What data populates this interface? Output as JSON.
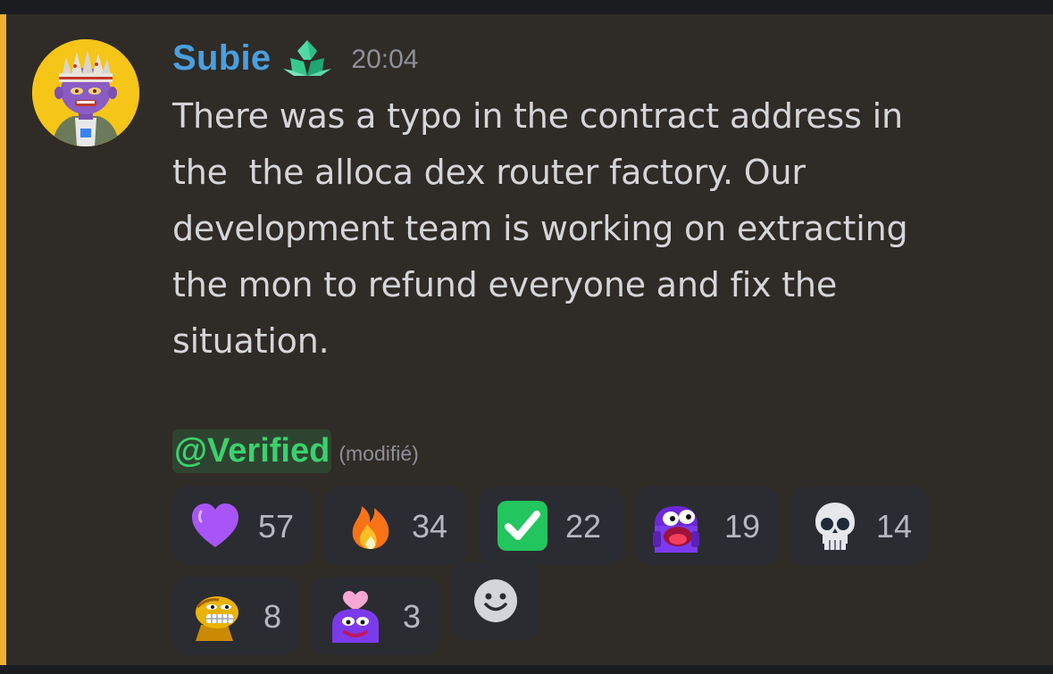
{
  "message": {
    "author": "Subie",
    "timestamp": "20:04",
    "content": "There was a typo in the contract address in\nthe  the alloca dex router factory. Our\ndevelopment team is working on extracting\nthe mon to refund everyone and fix the\nsituation.",
    "mention": "@Verified",
    "edited_label": "(modifié)",
    "role_icon": "green-crystal-icon",
    "highlight_color": "#f0b132",
    "username_color": "#4a9fe0",
    "mention_color": "#3ad26e"
  },
  "reactions": [
    {
      "emoji": "purple-heart-icon",
      "count": "57"
    },
    {
      "emoji": "fire-icon",
      "count": "34"
    },
    {
      "emoji": "check-mark-button-icon",
      "count": "22"
    },
    {
      "emoji": "pepe-scream-icon",
      "count": "19"
    },
    {
      "emoji": "skull-icon",
      "count": "14"
    },
    {
      "emoji": "grimace-face-icon",
      "count": "8"
    },
    {
      "emoji": "pepe-heart-icon",
      "count": "3"
    }
  ],
  "add_reaction": {
    "icon": "smiley-face-icon"
  }
}
